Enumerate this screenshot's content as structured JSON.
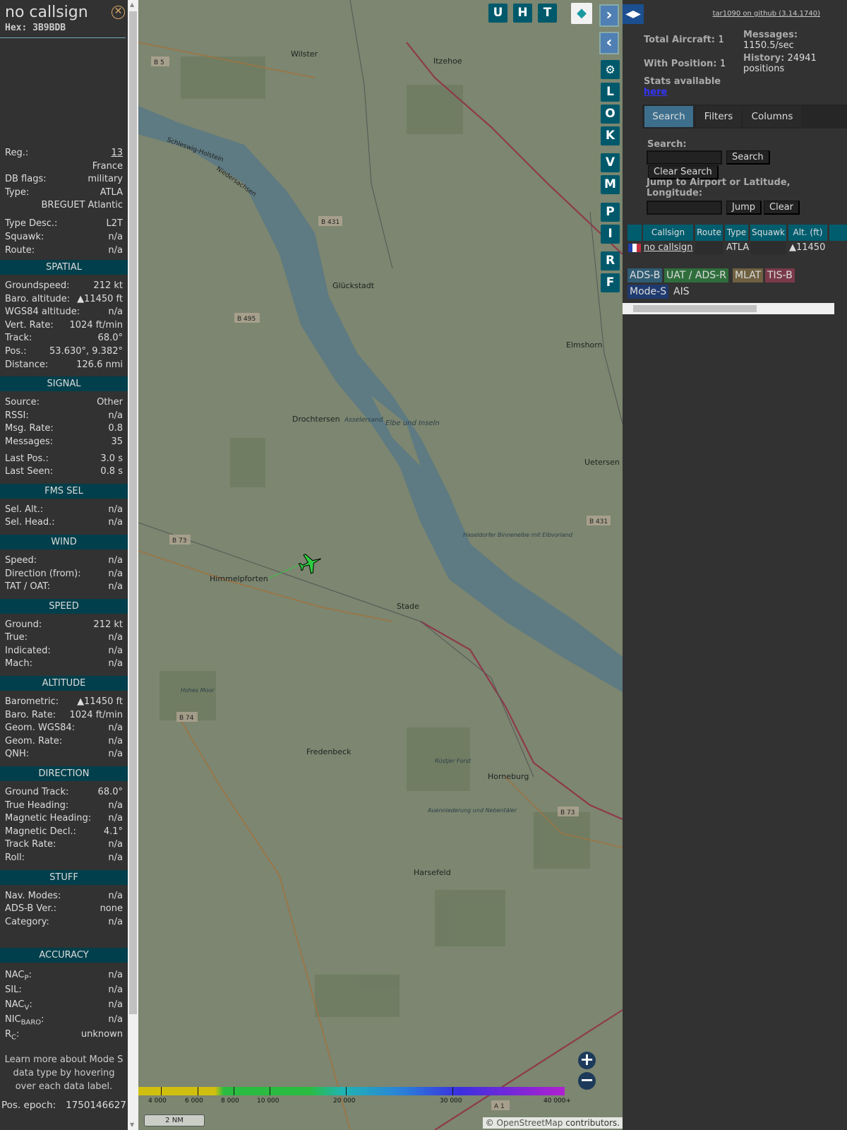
{
  "detail": {
    "callsign": "no callsign",
    "hex_label": "Hex:",
    "hex": "3B9BDB",
    "info": [
      {
        "label": "Reg.:",
        "value": "13",
        "link": true
      },
      {
        "label": "",
        "value": "France"
      },
      {
        "label": "DB flags:",
        "value": "military"
      },
      {
        "label": "Type:",
        "value": "ATLA"
      },
      {
        "label": "",
        "value": "BREGUET Atlantic"
      },
      {
        "label": "Type Desc.:",
        "value": "L2T"
      },
      {
        "label": "Squawk:",
        "value": "n/a"
      },
      {
        "label": "Route:",
        "value": "n/a"
      }
    ],
    "sections": [
      {
        "title": "SPATIAL",
        "rows": [
          [
            "Groundspeed:",
            "212 kt"
          ],
          [
            "Baro. altitude:",
            "▲11450 ft"
          ],
          [
            "WGS84 altitude:",
            "n/a"
          ],
          [
            "Vert. Rate:",
            "1024 ft/min"
          ],
          [
            "Track:",
            "68.0°"
          ],
          [
            "Pos.:",
            "53.630°, 9.382°"
          ],
          [
            "Distance:",
            "126.6 nmi"
          ]
        ]
      },
      {
        "title": "SIGNAL",
        "rows": [
          [
            "Source:",
            "Other"
          ],
          [
            "RSSI:",
            "n/a"
          ],
          [
            "Msg. Rate:",
            "0.8"
          ],
          [
            "Messages:",
            "35"
          ],
          [
            "Last Pos.:",
            "3.0 s"
          ],
          [
            "Last Seen:",
            "0.8 s"
          ]
        ]
      },
      {
        "title": "FMS SEL",
        "rows": [
          [
            "Sel. Alt.:",
            "n/a"
          ],
          [
            "Sel. Head.:",
            "n/a"
          ]
        ]
      },
      {
        "title": "WIND",
        "rows": [
          [
            "Speed:",
            "n/a"
          ],
          [
            "Direction (from):",
            "n/a"
          ],
          [
            "TAT / OAT:",
            "n/a"
          ]
        ]
      },
      {
        "title": "SPEED",
        "rows": [
          [
            "Ground:",
            "212 kt"
          ],
          [
            "True:",
            "n/a"
          ],
          [
            "Indicated:",
            "n/a"
          ],
          [
            "Mach:",
            "n/a"
          ]
        ]
      },
      {
        "title": "ALTITUDE",
        "rows": [
          [
            "Barometric:",
            "▲11450 ft"
          ],
          [
            "Baro. Rate:",
            "1024 ft/min"
          ],
          [
            "Geom. WGS84:",
            "n/a"
          ],
          [
            "Geom. Rate:",
            "n/a"
          ],
          [
            "QNH:",
            "n/a"
          ]
        ]
      },
      {
        "title": "DIRECTION",
        "rows": [
          [
            "Ground Track:",
            "68.0°"
          ],
          [
            "True Heading:",
            "n/a"
          ],
          [
            "Magnetic Heading:",
            "n/a"
          ],
          [
            "Magnetic Decl.:",
            "4.1°"
          ],
          [
            "Track Rate:",
            "n/a"
          ],
          [
            "Roll:",
            "n/a"
          ]
        ]
      },
      {
        "title": "STUFF",
        "rows": [
          [
            "Nav. Modes:",
            "n/a"
          ],
          [
            "ADS-B Ver.:",
            "none"
          ],
          [
            "Category:",
            "n/a"
          ]
        ]
      }
    ],
    "accuracy": {
      "title": "ACCURACY",
      "rows": [
        {
          "label": "NAC",
          "sub": "P",
          "tail": ":",
          "value": "n/a"
        },
        {
          "label": "SIL:",
          "sub": "",
          "tail": "",
          "value": "n/a"
        },
        {
          "label": "NAC",
          "sub": "V",
          "tail": ":",
          "value": "n/a"
        },
        {
          "label": "NIC",
          "sub": "BARO",
          "tail": ":",
          "value": "n/a"
        },
        {
          "label": "R",
          "sub": "C",
          "tail": ":",
          "value": "unknown"
        }
      ]
    },
    "learn_more": "Learn more about Mode S data type by hovering over each data label.",
    "pos_epoch_label": "Pos. epoch:",
    "pos_epoch": "1750146627"
  },
  "map": {
    "top_buttons": [
      "U",
      "H",
      "T"
    ],
    "side_buttons": [
      "L",
      "O",
      "K",
      "V",
      "M",
      "P",
      "I",
      "R",
      "F"
    ],
    "places": [
      "Wilster",
      "Itzehoe",
      "Glückstadt",
      "Elmshorn",
      "Drochtersen",
      "Uetersen",
      "Himmelpforten",
      "Stade",
      "Fredenbeck",
      "Horneburg",
      "Harsefeld",
      "Asselersand",
      "Elbe und Inseln",
      "Haseldorfer Binnenelbe mit Elbvorland",
      "Hohes Moor",
      "Rüstjer Forst",
      "Auenniederung und Nebentäler",
      "Schleswig-Holstein",
      "Niedersachsen"
    ],
    "roads": [
      "B 5",
      "B 431",
      "B 495",
      "B 431",
      "B 73",
      "B 74",
      "B 73",
      "A 1"
    ],
    "color_scale": {
      "ticks": [
        "4 000",
        "6 000",
        "8 000",
        "10 000",
        "20 000",
        "30 000",
        "40 000+"
      ]
    },
    "scale_bar": "2 NM",
    "attribution_prefix": "© ",
    "attribution_link": "OpenStreetMap",
    "attribution_suffix": " contributors."
  },
  "right": {
    "github": "tar1090 on github (3.14.1740)",
    "total_label": "Total Aircraft:",
    "total": "1",
    "withpos_label": "With Position:",
    "withpos": "1",
    "messages_label": "Messages:",
    "messages": "1150.5/sec",
    "history_label": "History:",
    "history": "24941",
    "history_unit": "positions",
    "stats": "Stats available",
    "stats_link": "here",
    "tabs": [
      "Search",
      "Filters",
      "Columns"
    ],
    "search_label": "Search:",
    "search_value": "",
    "search_btn": "Search",
    "clear_search": "Clear Search",
    "jump_label": "Jump to Airport or Latitude, Longitude:",
    "jump_value": "",
    "jump_btn": "Jump",
    "clear_btn": "Clear",
    "columns": [
      "Callsign",
      "Route",
      "Type",
      "Squawk",
      "Alt. (ft)"
    ],
    "rows": [
      {
        "callsign": "no callsign",
        "route": "",
        "type": "ATLA",
        "squawk": "",
        "alt": "▲11450"
      }
    ],
    "legend": [
      "ADS-B",
      "UAT / ADS-R",
      "MLAT",
      "TIS-B",
      "Mode-S",
      "AIS"
    ]
  },
  "colors": {
    "panel": "#323232",
    "header": "#003f4b",
    "button": "#00596b",
    "aircraft": "#2ecc40"
  }
}
